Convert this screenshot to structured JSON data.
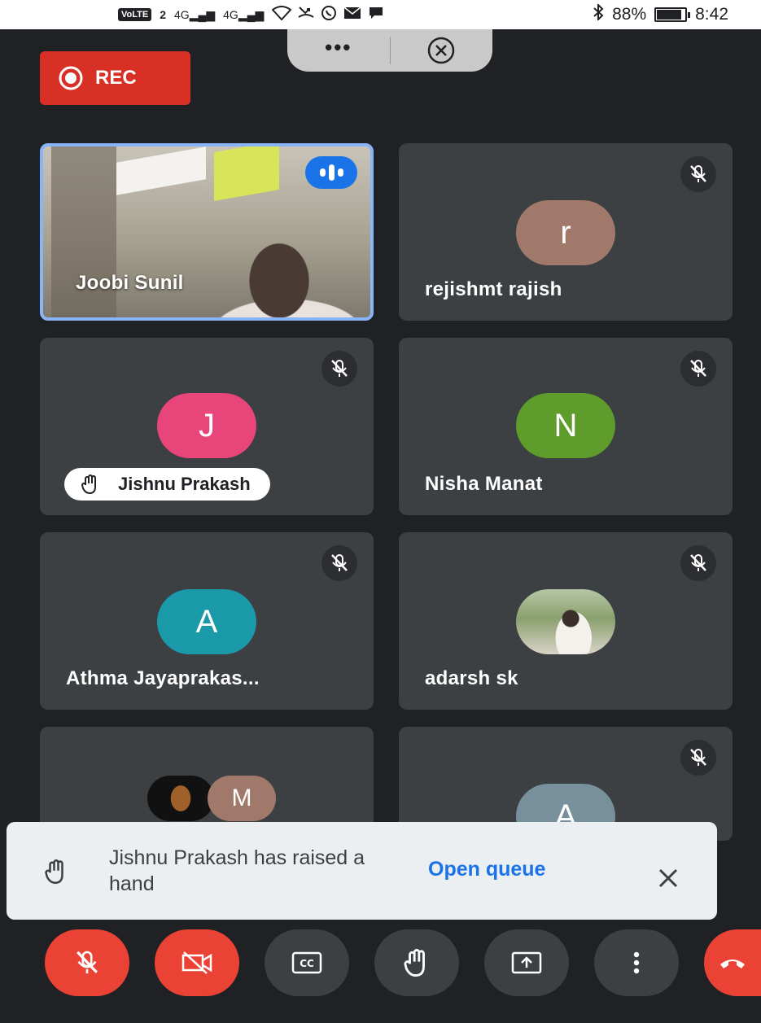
{
  "status_bar": {
    "volte": "VoLTE",
    "sim": "2",
    "signal1": "4G",
    "signal2": "4G",
    "battery": "88%",
    "time": "8:42"
  },
  "top": {
    "more_label": "•••",
    "rec_label": "REC"
  },
  "participants": [
    {
      "name": "Joobi Sunil"
    },
    {
      "name": "rejishmt rajish",
      "initial": "r",
      "color": "#a1796a"
    },
    {
      "name": "Jishnu Prakash",
      "initial": "J",
      "color": "#e8457a"
    },
    {
      "name": "Nisha Manat",
      "initial": "N",
      "color": "#5e9c2c"
    },
    {
      "name": "Athma Jayaprakas...",
      "initial": "A",
      "color": "#1a9aa8"
    },
    {
      "name": "adarsh sk"
    },
    {
      "name": "",
      "initial": "M",
      "color": "#a1796a"
    },
    {
      "name": "",
      "initial": "A",
      "color": "#78909c"
    }
  ],
  "toast": {
    "message": "Jishnu Prakash has raised a hand",
    "action": "Open queue"
  },
  "colors": {
    "background": "#202124",
    "tile": "#3c4043",
    "red": "#ea4335",
    "blue": "#1a73e8"
  }
}
